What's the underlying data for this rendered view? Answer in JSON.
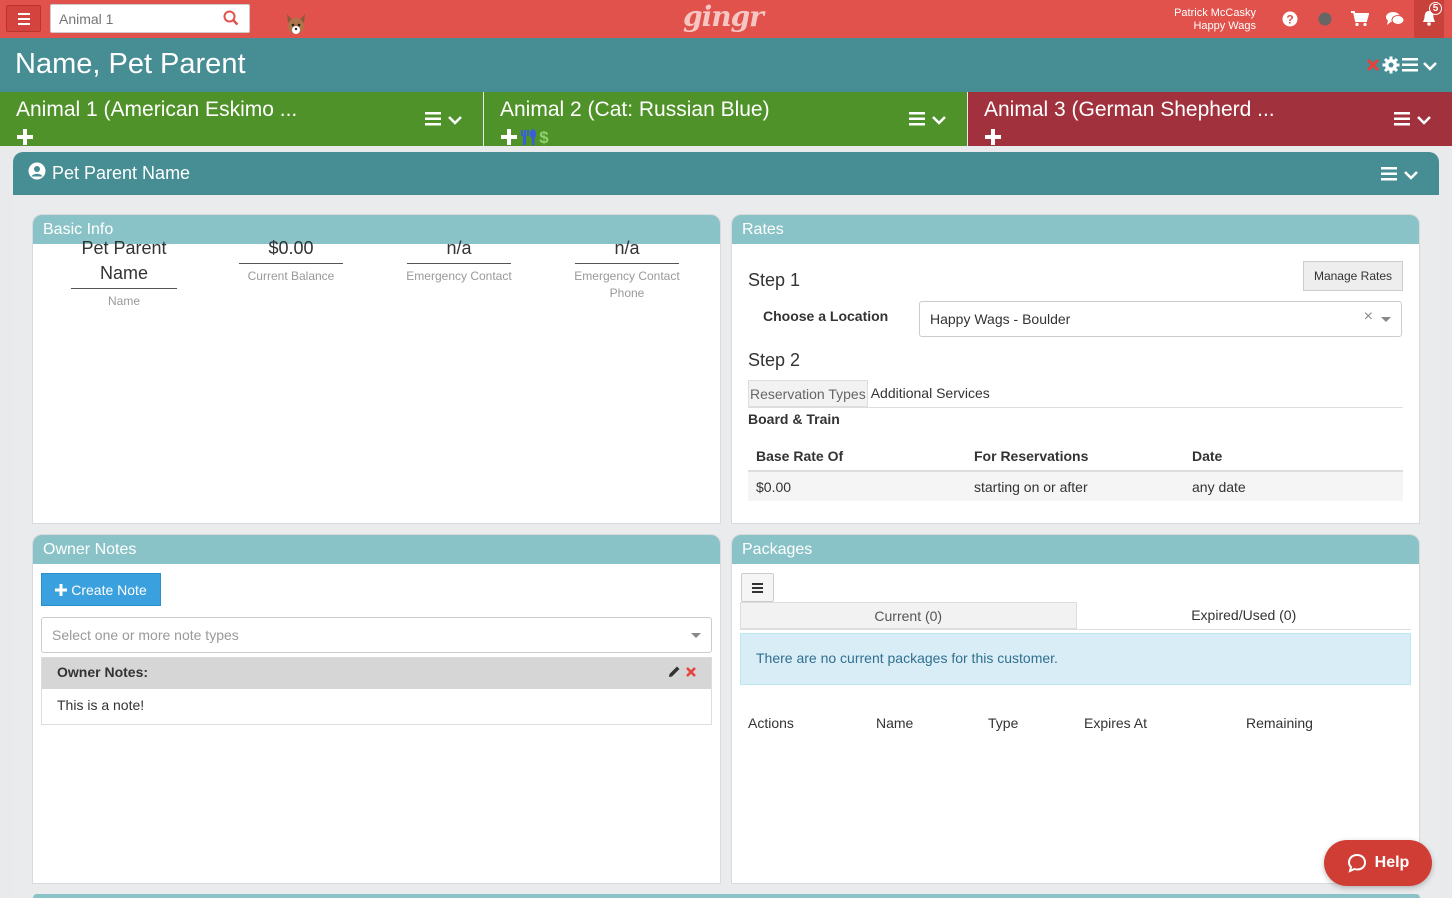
{
  "topbar": {
    "search_placeholder": "Animal 1",
    "logo": "gingr",
    "user_name": "Patrick McCasky",
    "user_location": "Happy Wags",
    "notification_count": "5"
  },
  "title": "Name, Pet Parent",
  "animals": [
    {
      "name": "Animal 1 (American Eskimo ...",
      "color": "#4f9229"
    },
    {
      "name": "Animal 2 (Cat: Russian Blue)",
      "color": "#4f9229"
    },
    {
      "name": "Animal 3 (German Shepherd ...",
      "color": "#a1313c"
    }
  ],
  "parent_section": {
    "title": "Pet Parent Name"
  },
  "basic_info": {
    "title": "Basic Info",
    "fields": [
      {
        "value": "Pet Parent Name",
        "label": "Name"
      },
      {
        "value": "$0.00",
        "label": "Current Balance"
      },
      {
        "value": "n/a",
        "label": "Emergency Contact"
      },
      {
        "value": "n/a",
        "label": "Emergency Contact Phone"
      }
    ]
  },
  "rates": {
    "title": "Rates",
    "step1": "Step 1",
    "manage_button": "Manage Rates",
    "location_label": "Choose a Location",
    "location_value": "Happy Wags - Boulder",
    "clear_symbol": "×",
    "step2": "Step 2",
    "tabs": [
      "Reservation Types",
      "Additional Services"
    ],
    "subhead": "Board & Train",
    "table": {
      "headers": [
        "Base Rate Of",
        "For Reservations",
        "Date"
      ],
      "rows": [
        [
          "$0.00",
          "starting on or after",
          "any date"
        ]
      ]
    }
  },
  "owner_notes": {
    "title": "Owner Notes",
    "create_button": "Create Note",
    "filter_placeholder": "Select one or more note types",
    "note_title": "Owner Notes:",
    "note_body": "This is a note!"
  },
  "packages": {
    "title": "Packages",
    "tabs": [
      "Current (0)",
      "Expired/Used (0)"
    ],
    "empty_message": "There are no current packages for this customer.",
    "columns": [
      "Actions",
      "Name",
      "Type",
      "Expires At",
      "Remaining"
    ]
  },
  "help_button": "Help",
  "colors": {
    "topbar": "#e0524b",
    "teal": "#478d94",
    "panel_head": "#89c3c7",
    "green": "#4f9229",
    "maroon": "#a1313c",
    "blue_button": "#3aa1de"
  }
}
